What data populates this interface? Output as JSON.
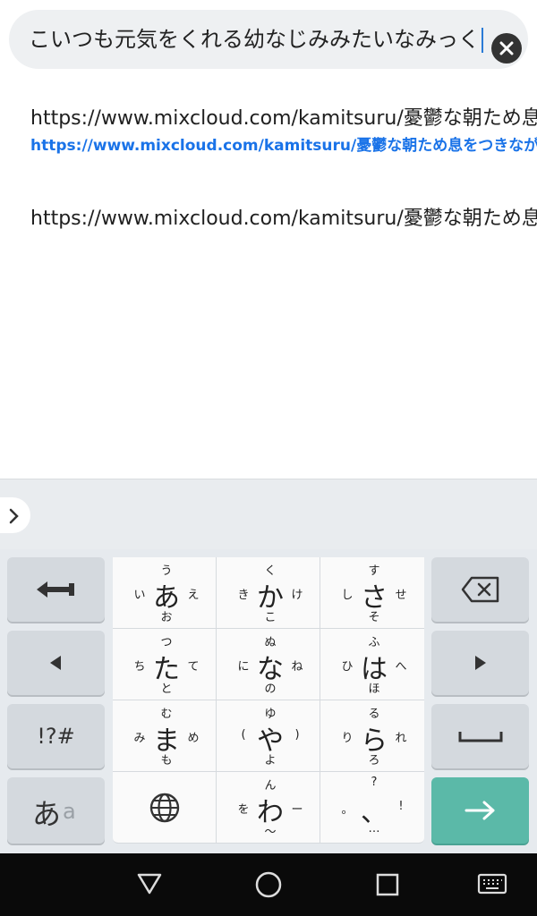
{
  "search": {
    "text": "こいつも元気をくれる幼なじみみたいなみっくす/"
  },
  "suggestions": [
    {
      "text": "https://www.mixcloud.com/kamitsuru/憂鬱な朝ため息を",
      "link": "https://www.mixcloud.com/kamitsuru/憂鬱な朝ため息をつきなが"
    },
    {
      "text": "https://www.mixcloud.com/kamitsuru/憂鬱な朝ため息を"
    }
  ],
  "keyboard": {
    "keys": {
      "a": {
        "main": "あ",
        "top": "う",
        "bottom": "お",
        "left": "い",
        "right": "え"
      },
      "ka": {
        "main": "か",
        "top": "く",
        "bottom": "こ",
        "left": "き",
        "right": "け"
      },
      "sa": {
        "main": "さ",
        "top": "す",
        "bottom": "そ",
        "left": "し",
        "right": "せ"
      },
      "ta": {
        "main": "た",
        "top": "つ",
        "bottom": "と",
        "left": "ち",
        "right": "て"
      },
      "na": {
        "main": "な",
        "top": "ぬ",
        "bottom": "の",
        "left": "に",
        "right": "ね"
      },
      "ha": {
        "main": "は",
        "top": "ふ",
        "bottom": "ほ",
        "left": "ひ",
        "right": "へ"
      },
      "ma": {
        "main": "ま",
        "top": "む",
        "bottom": "も",
        "left": "み",
        "right": "め"
      },
      "ya": {
        "main": "や",
        "top": "ゆ",
        "bottom": "よ",
        "left": "(",
        "right": ")"
      },
      "ra": {
        "main": "ら",
        "top": "る",
        "bottom": "ろ",
        "left": "り",
        "right": "れ"
      },
      "wa": {
        "main": "わ",
        "top": "ん",
        "bottom": "〜",
        "left": "を",
        "right": "ー"
      },
      "punct": {
        "main": "、",
        "top": "?",
        "bottom": "…",
        "left": "。",
        "right": "!"
      }
    },
    "symbols_label": "!?#",
    "mode_label_main": "あ",
    "mode_label_sub": "a"
  }
}
